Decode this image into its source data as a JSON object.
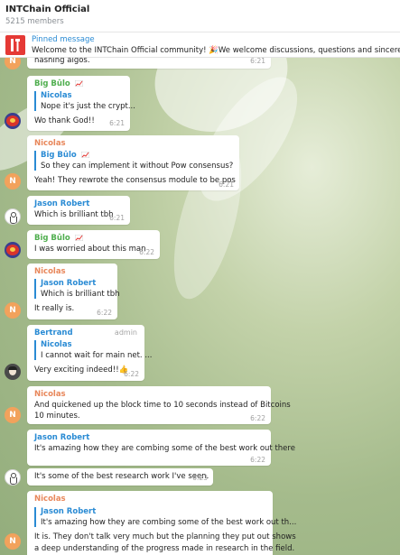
{
  "chat": {
    "title": "INTChain Official",
    "members": "5215 members"
  },
  "pinned": {
    "label": "Pinned message",
    "text": "Welcome to the INTChain Official community! 🎉We welcome discussions, questions and sincerely appre"
  },
  "messages": [
    {
      "text": "hashing algos.",
      "time": "6:21"
    },
    {
      "sender": "Big Bûlo",
      "reply_name": "Nicolas",
      "reply_text": "Nope it's just the crypt...",
      "text": "Wo thank God!!",
      "time": "6:21"
    },
    {
      "sender": "Nicolas",
      "reply_name": "Big Bûlo",
      "reply_text": "So they can implement it without Pow consensus?",
      "text": "Yeah! They rewrote the consensus module to be pos",
      "time": "6:21"
    },
    {
      "sender": "Jason Robert",
      "text": "Which is brilliant tbh",
      "time": "6:21"
    },
    {
      "sender": "Big Bûlo",
      "text": "I was worried about this man",
      "time": "6:22"
    },
    {
      "sender": "Nicolas",
      "reply_name": "Jason Robert",
      "reply_text": "Which is brilliant tbh",
      "text": "It really is.",
      "time": "6:22"
    },
    {
      "sender": "Bertrand",
      "role": "admin",
      "reply_name": "Nicolas",
      "reply_text": "I cannot wait for main net. ...",
      "text": "Very exciting indeed!!👍",
      "time": "6:22"
    },
    {
      "sender": "Nicolas",
      "text_line1": "And quickened up the block time to 10 seconds instead of Bitcoins",
      "text_line2": "10 minutes.",
      "time": "6:22"
    },
    {
      "sender": "Jason Robert",
      "text": "It's amazing how they are combing some of the best work out there",
      "time": "6:22"
    },
    {
      "text": "It's some of the best research work I've seen.",
      "time": "6:23"
    },
    {
      "sender": "Nicolas",
      "reply_name": "Jason Robert",
      "reply_text": "It's amazing how they are combing some of the best work out th...",
      "text_line1": "It is. They don't talk very much but the planning they put out shows",
      "text_line2": "a deep understanding of the progress made in research in the field."
    }
  ],
  "avatars": {
    "n_letter": "N"
  },
  "colors": {
    "name_green": "#4fae4e",
    "name_orange": "#e8875b",
    "name_blue": "#2a8bd4",
    "pinned_thumb": "#e53935"
  }
}
